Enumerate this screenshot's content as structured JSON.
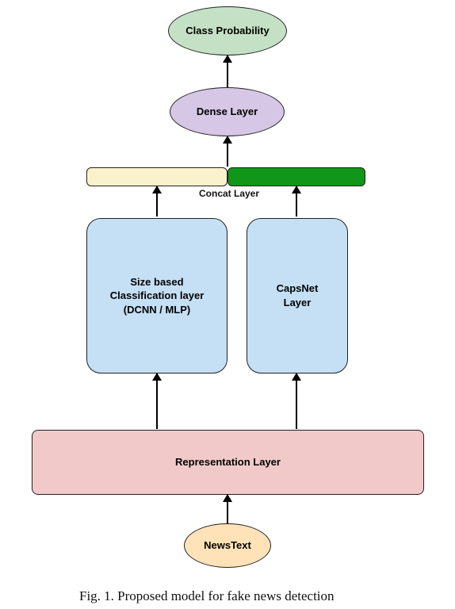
{
  "nodes": {
    "class_prob": "Class Probability",
    "dense": "Dense Layer",
    "concat": "Concat Layer",
    "size_cls": "Size based\nClassification layer\n(DCNN / MLP)",
    "capsnet": "CapsNet\nLayer",
    "repr": "Representation Layer",
    "newstext": "NewsText"
  },
  "colors": {
    "class_prob": "#c5e1c5",
    "dense": "#d6c7e6",
    "size_cls": "#c5dff5",
    "capsnet": "#c5dff5",
    "repr": "#f2c9c9",
    "newstext": "#ffe2b8",
    "concat_l": "#faf2cc",
    "concat_r": "#109618"
  },
  "caption": "Fig. 1. Proposed model for fake news detection"
}
